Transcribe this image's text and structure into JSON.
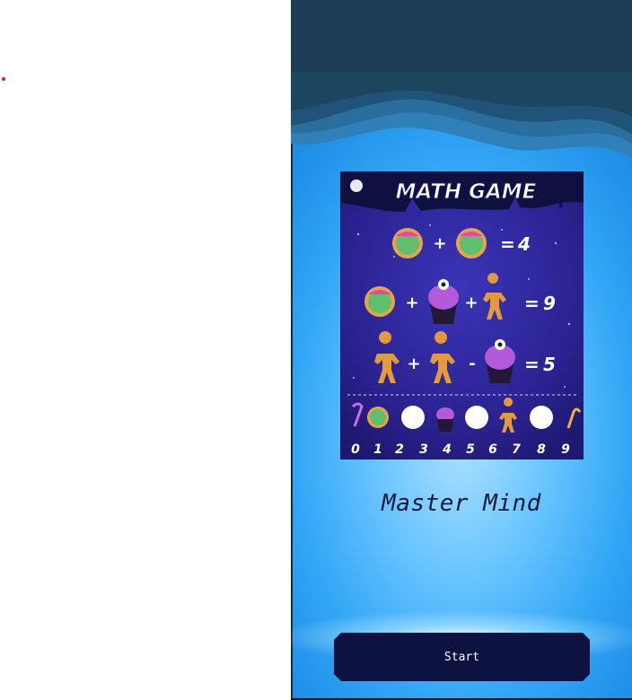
{
  "app": {
    "title": "Master Mind",
    "start_label": "Start"
  },
  "game_image": {
    "heading": "MATH GAME",
    "equations": [
      {
        "result": "4"
      },
      {
        "result": "9"
      },
      {
        "result": "5"
      }
    ],
    "digits": [
      "0",
      "1",
      "2",
      "3",
      "4",
      "5",
      "6",
      "7",
      "8",
      "9"
    ]
  },
  "colors": {
    "accent_button": "#0d1240",
    "background_top": "#1c3a52",
    "background_mid": "#6cc6ff",
    "title_text": "#0f1a3c"
  }
}
